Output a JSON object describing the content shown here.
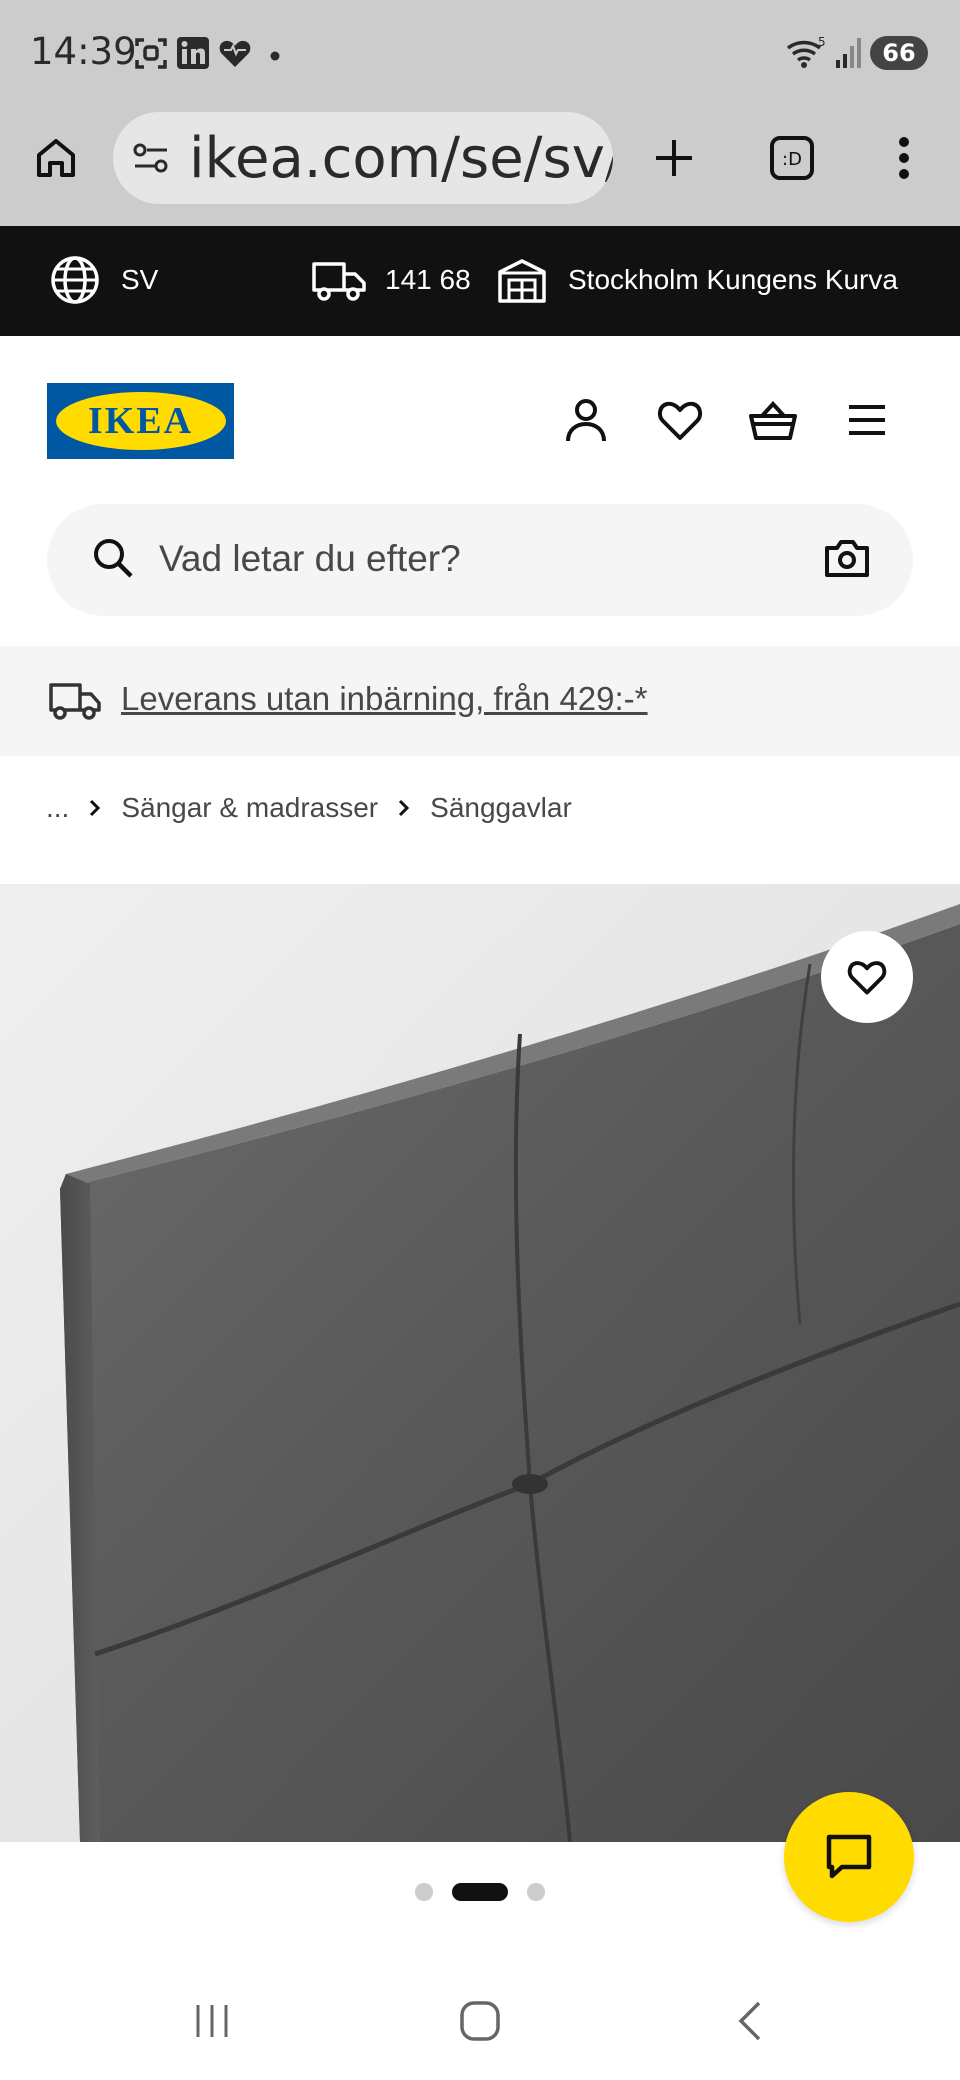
{
  "status_bar": {
    "time": "14:39",
    "battery": "66",
    "icons": [
      "screenshot-icon",
      "linkedin-icon",
      "heart-icon",
      "notification-dot-icon",
      "wifi-icon",
      "signal-icon",
      "battery-icon"
    ]
  },
  "browser": {
    "url": "ikea.com/se/sv/p",
    "tab_count_label": ":D",
    "icons": [
      "home-icon",
      "site-settings-icon",
      "new-tab-icon",
      "tabs-icon",
      "menu-kebab-icon"
    ]
  },
  "top_strip": {
    "language": "SV",
    "postal_code": "141 68",
    "store": "Stockholm Kungens Kurva"
  },
  "header": {
    "logo_text": "IKEA",
    "icons": [
      "profile-icon",
      "wishlist-icon",
      "basket-icon",
      "hamburger-menu-icon"
    ]
  },
  "search": {
    "placeholder": "Vad letar du efter?"
  },
  "delivery_banner": {
    "text": "Leverans utan inbärning, från 429:-*"
  },
  "breadcrumb": {
    "ellipsis": "...",
    "items": [
      "Sängar & madrasser",
      "Sänggavlar"
    ]
  },
  "carousel": {
    "total": 3,
    "active_index": 1
  },
  "colors": {
    "ikea_blue": "#0058a3",
    "ikea_yellow": "#ffdb00",
    "strip_black": "#111111"
  }
}
